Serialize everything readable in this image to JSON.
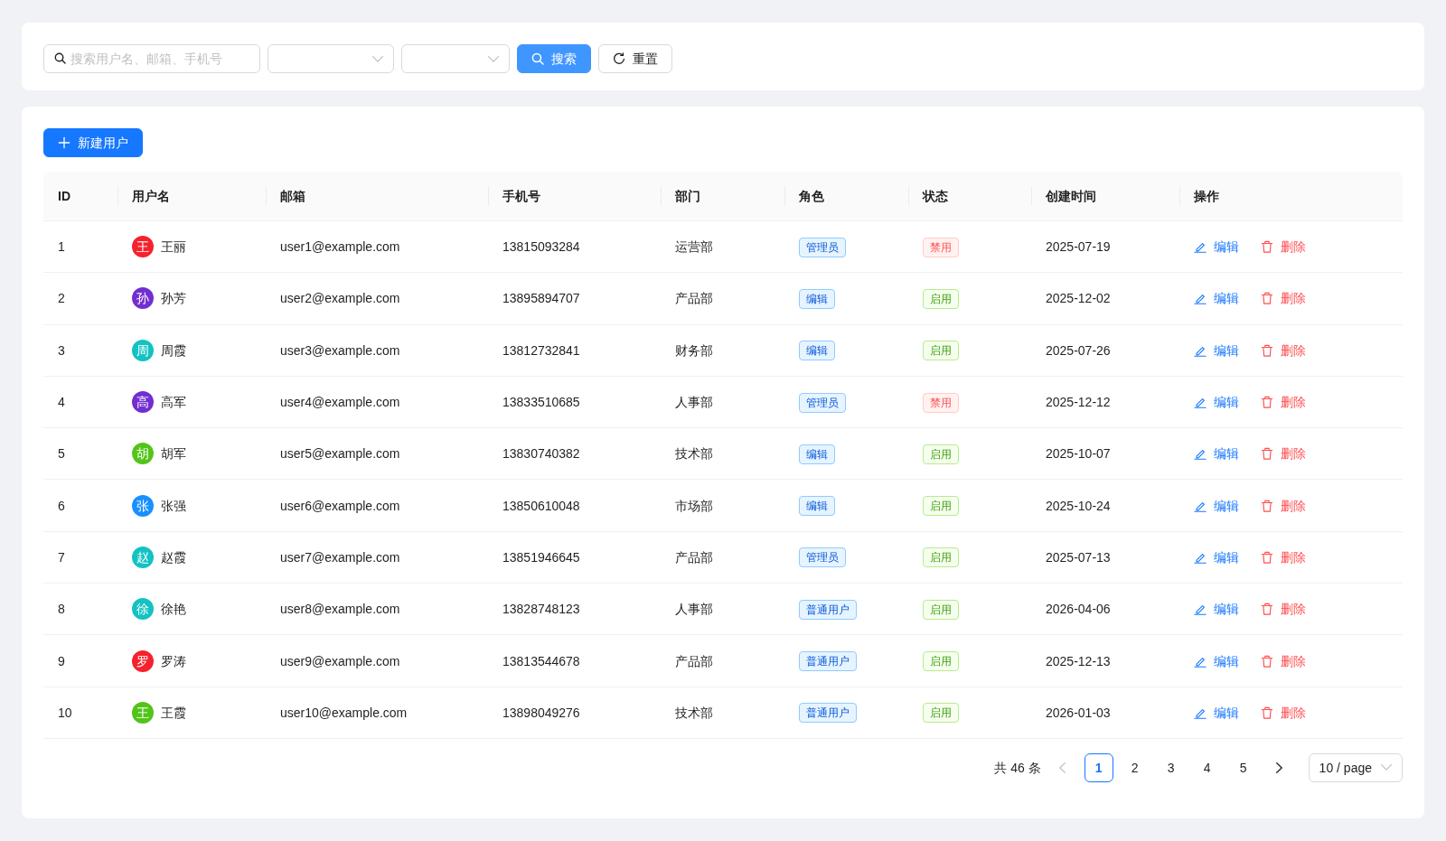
{
  "toolbar": {
    "search": {
      "placeholder": "搜索用户名、邮箱、手机号"
    },
    "filters": [
      {
        "kind": "select"
      },
      {
        "kind": "select"
      }
    ],
    "buttons": [
      {
        "kind": "search",
        "label": "搜索"
      },
      {
        "kind": "reset",
        "label": "重置"
      }
    ]
  },
  "create_button": {
    "label": "新建用户"
  },
  "table": {
    "columns": [
      "ID",
      "用户名",
      "邮箱",
      "手机号",
      "部门",
      "角色",
      "状态",
      "创建时间",
      "操作"
    ],
    "rows": [
      {
        "id": "1",
        "avatar": {
          "text": "王",
          "color": "#f5222d"
        },
        "username": "王丽",
        "email": "user1@example.com",
        "phone": "13815093284",
        "department": "运营部",
        "role": "管理员",
        "status": {
          "label": "禁用",
          "enabled": false
        },
        "created": "2025-07-19",
        "actions": [
          {
            "kind": "edit",
            "label": "编辑"
          },
          {
            "kind": "delete",
            "label": "删除"
          }
        ]
      },
      {
        "id": "2",
        "avatar": {
          "text": "孙",
          "color": "#722ed1"
        },
        "username": "孙芳",
        "email": "user2@example.com",
        "phone": "13895894707",
        "department": "产品部",
        "role": "编辑",
        "status": {
          "label": "启用",
          "enabled": true
        },
        "created": "2025-12-02",
        "actions": [
          {
            "kind": "edit",
            "label": "编辑"
          },
          {
            "kind": "delete",
            "label": "删除"
          }
        ]
      },
      {
        "id": "3",
        "avatar": {
          "text": "周",
          "color": "#13c2c2"
        },
        "username": "周霞",
        "email": "user3@example.com",
        "phone": "13812732841",
        "department": "财务部",
        "role": "编辑",
        "status": {
          "label": "启用",
          "enabled": true
        },
        "created": "2025-07-26",
        "actions": [
          {
            "kind": "edit",
            "label": "编辑"
          },
          {
            "kind": "delete",
            "label": "删除"
          }
        ]
      },
      {
        "id": "4",
        "avatar": {
          "text": "高",
          "color": "#722ed1"
        },
        "username": "高军",
        "email": "user4@example.com",
        "phone": "13833510685",
        "department": "人事部",
        "role": "管理员",
        "status": {
          "label": "禁用",
          "enabled": false
        },
        "created": "2025-12-12",
        "actions": [
          {
            "kind": "edit",
            "label": "编辑"
          },
          {
            "kind": "delete",
            "label": "删除"
          }
        ]
      },
      {
        "id": "5",
        "avatar": {
          "text": "胡",
          "color": "#52c41a"
        },
        "username": "胡军",
        "email": "user5@example.com",
        "phone": "13830740382",
        "department": "技术部",
        "role": "编辑",
        "status": {
          "label": "启用",
          "enabled": true
        },
        "created": "2025-10-07",
        "actions": [
          {
            "kind": "edit",
            "label": "编辑"
          },
          {
            "kind": "delete",
            "label": "删除"
          }
        ]
      },
      {
        "id": "6",
        "avatar": {
          "text": "张",
          "color": "#1890ff"
        },
        "username": "张强",
        "email": "user6@example.com",
        "phone": "13850610048",
        "department": "市场部",
        "role": "编辑",
        "status": {
          "label": "启用",
          "enabled": true
        },
        "created": "2025-10-24",
        "actions": [
          {
            "kind": "edit",
            "label": "编辑"
          },
          {
            "kind": "delete",
            "label": "删除"
          }
        ]
      },
      {
        "id": "7",
        "avatar": {
          "text": "赵",
          "color": "#13c2c2"
        },
        "username": "赵霞",
        "email": "user7@example.com",
        "phone": "13851946645",
        "department": "产品部",
        "role": "管理员",
        "status": {
          "label": "启用",
          "enabled": true
        },
        "created": "2025-07-13",
        "actions": [
          {
            "kind": "edit",
            "label": "编辑"
          },
          {
            "kind": "delete",
            "label": "删除"
          }
        ]
      },
      {
        "id": "8",
        "avatar": {
          "text": "徐",
          "color": "#13c2c2"
        },
        "username": "徐艳",
        "email": "user8@example.com",
        "phone": "13828748123",
        "department": "人事部",
        "role": "普通用户",
        "status": {
          "label": "启用",
          "enabled": true
        },
        "created": "2026-04-06",
        "actions": [
          {
            "kind": "edit",
            "label": "编辑"
          },
          {
            "kind": "delete",
            "label": "删除"
          }
        ]
      },
      {
        "id": "9",
        "avatar": {
          "text": "罗",
          "color": "#f5222d"
        },
        "username": "罗涛",
        "email": "user9@example.com",
        "phone": "13813544678",
        "department": "产品部",
        "role": "普通用户",
        "status": {
          "label": "启用",
          "enabled": true
        },
        "created": "2025-12-13",
        "actions": [
          {
            "kind": "edit",
            "label": "编辑"
          },
          {
            "kind": "delete",
            "label": "删除"
          }
        ]
      },
      {
        "id": "10",
        "avatar": {
          "text": "王",
          "color": "#52c41a"
        },
        "username": "王霞",
        "email": "user10@example.com",
        "phone": "13898049276",
        "department": "技术部",
        "role": "普通用户",
        "status": {
          "label": "启用",
          "enabled": true
        },
        "created": "2026-01-03",
        "actions": [
          {
            "kind": "edit",
            "label": "编辑"
          },
          {
            "kind": "delete",
            "label": "删除"
          }
        ]
      }
    ]
  },
  "pagination": {
    "total": "共 46 条",
    "prev": {
      "disabled": true
    },
    "pages": [
      {
        "label": "1",
        "selected": true
      },
      {
        "label": "2",
        "selected": false
      },
      {
        "label": "3",
        "selected": false
      },
      {
        "label": "4",
        "selected": false
      },
      {
        "label": "5",
        "selected": false
      }
    ],
    "next": {
      "disabled": false
    },
    "page_size": "10 / page"
  }
}
